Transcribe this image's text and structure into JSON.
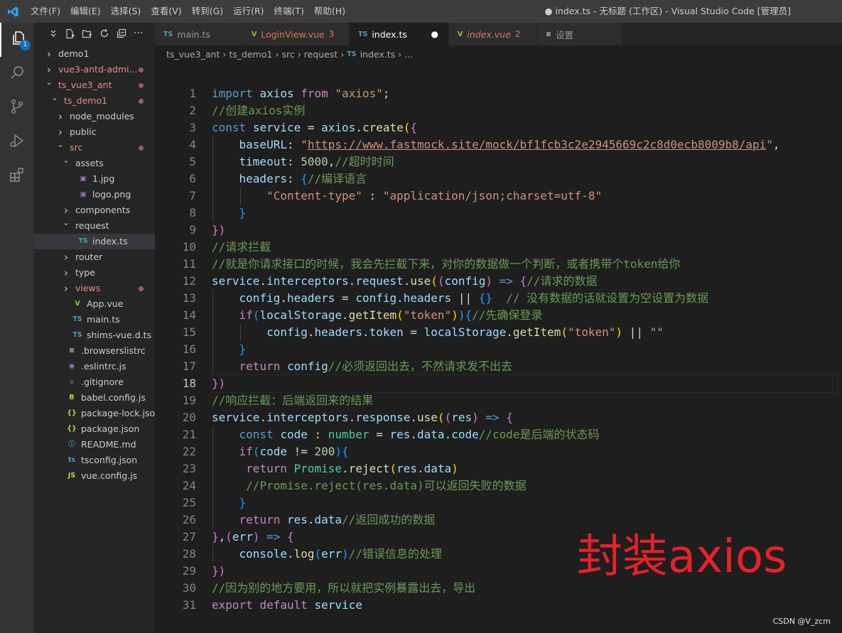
{
  "menu": [
    "文件(F)",
    "编辑(E)",
    "选择(S)",
    "查看(V)",
    "转到(G)",
    "运行(R)",
    "终端(T)",
    "帮助(H)"
  ],
  "window_title": "● index.ts - 无标题 (工作区) - Visual Studio Code [管理员]",
  "activity_badge": "1",
  "tabs": [
    {
      "badge": "TS",
      "label": "main.ts",
      "suffix": ""
    },
    {
      "badge": "V",
      "label": "LoginView.vue",
      "suffix": "3"
    },
    {
      "badge": "TS",
      "label": "index.ts",
      "suffix": "●"
    },
    {
      "badge": "V",
      "label": "index.vue",
      "suffix": "2"
    },
    {
      "badge": "≡",
      "label": "设置",
      "suffix": ""
    }
  ],
  "breadcrumb": [
    "ts_vue3_ant",
    "ts_demo1",
    "src",
    "request",
    "index.ts",
    "..."
  ],
  "explorer": [
    {
      "label": "demo1",
      "kind": "folder-closed",
      "depth": 0,
      "dot": false
    },
    {
      "label": "vue3-antd-admi...",
      "kind": "folder-closed",
      "depth": 0,
      "dot": true
    },
    {
      "label": "ts_vue3_ant",
      "kind": "folder-open",
      "depth": 0,
      "dot": true
    },
    {
      "label": "ts_demo1",
      "kind": "folder-open",
      "depth": 1,
      "dot": true
    },
    {
      "label": "node_modules",
      "kind": "folder-closed",
      "depth": 2,
      "dot": false
    },
    {
      "label": "public",
      "kind": "folder-closed",
      "depth": 2,
      "dot": false
    },
    {
      "label": "src",
      "kind": "folder-open",
      "depth": 2,
      "dot": true
    },
    {
      "label": "assets",
      "kind": "folder-open",
      "depth": 3,
      "dot": false
    },
    {
      "label": "1.jpg",
      "kind": "image",
      "depth": 4,
      "dot": false
    },
    {
      "label": "logo.png",
      "kind": "image",
      "depth": 4,
      "dot": false
    },
    {
      "label": "components",
      "kind": "folder-closed",
      "depth": 3,
      "dot": false
    },
    {
      "label": "request",
      "kind": "folder-open",
      "depth": 3,
      "dot": false
    },
    {
      "label": "index.ts",
      "kind": "ts",
      "depth": 4,
      "dot": false,
      "selected": true
    },
    {
      "label": "router",
      "kind": "folder-closed",
      "depth": 3,
      "dot": false
    },
    {
      "label": "type",
      "kind": "folder-closed",
      "depth": 3,
      "dot": false
    },
    {
      "label": "views",
      "kind": "folder-closed",
      "depth": 3,
      "dot": true
    },
    {
      "label": "App.vue",
      "kind": "vue",
      "depth": 3,
      "dot": false
    },
    {
      "label": "main.ts",
      "kind": "ts",
      "depth": 3,
      "dot": false
    },
    {
      "label": "shims-vue.d.ts",
      "kind": "ts",
      "depth": 3,
      "dot": false
    },
    {
      "label": ".browserslistrc",
      "kind": "lines",
      "depth": 2,
      "dot": false
    },
    {
      "label": ".eslintrc.js",
      "kind": "eslint",
      "depth": 2,
      "dot": false
    },
    {
      "label": ".gitignore",
      "kind": "git",
      "depth": 2,
      "dot": false
    },
    {
      "label": "babel.config.js",
      "kind": "babel",
      "depth": 2,
      "dot": false
    },
    {
      "label": "package-lock.json",
      "kind": "json",
      "depth": 2,
      "dot": false
    },
    {
      "label": "package.json",
      "kind": "json",
      "depth": 2,
      "dot": false
    },
    {
      "label": "README.md",
      "kind": "info",
      "depth": 2,
      "dot": false
    },
    {
      "label": "tsconfig.json",
      "kind": "tsconfig",
      "depth": 2,
      "dot": false
    },
    {
      "label": "vue.config.js",
      "kind": "js",
      "depth": 2,
      "dot": false
    }
  ],
  "current_line": 18,
  "code_lines": [
    [
      [
        "k",
        "import"
      ],
      [
        "p",
        " "
      ],
      [
        "v",
        "axios"
      ],
      [
        "p",
        " "
      ],
      [
        "kc",
        "from"
      ],
      [
        "p",
        " "
      ],
      [
        "s",
        "\"axios\""
      ],
      [
        "p",
        ";"
      ]
    ],
    [
      [
        "c",
        "//创建axios实例"
      ]
    ],
    [
      [
        "k",
        "const"
      ],
      [
        "p",
        " "
      ],
      [
        "v",
        "service"
      ],
      [
        "p",
        " = "
      ],
      [
        "v",
        "axios"
      ],
      [
        "p",
        "."
      ],
      [
        "f",
        "create"
      ],
      [
        "b1",
        "("
      ],
      [
        "b2",
        "{"
      ]
    ],
    [
      [
        "p",
        "    "
      ],
      [
        "v",
        "baseURL"
      ],
      [
        "p",
        ": "
      ],
      [
        "s",
        "\""
      ],
      [
        "su",
        "https://www.fastmock.site/mock/bf1fcb3c2e2945669c2c8d0ecb8009b8/api"
      ],
      [
        "s",
        "\""
      ],
      [
        "p",
        ","
      ]
    ],
    [
      [
        "p",
        "    "
      ],
      [
        "v",
        "timeout"
      ],
      [
        "p",
        ": "
      ],
      [
        "n",
        "5000"
      ],
      [
        "p",
        ","
      ],
      [
        "c",
        "//超时时间"
      ]
    ],
    [
      [
        "p",
        "    "
      ],
      [
        "v",
        "headers"
      ],
      [
        "p",
        ": "
      ],
      [
        "b3",
        "{"
      ],
      [
        "c",
        "//编译语言"
      ]
    ],
    [
      [
        "p",
        "        "
      ],
      [
        "s",
        "\"Content-type\""
      ],
      [
        "p",
        " : "
      ],
      [
        "s",
        "\"application/json;charset=utf-8\""
      ]
    ],
    [
      [
        "p",
        "    "
      ],
      [
        "b3",
        "}"
      ]
    ],
    [
      [
        "b2",
        "})"
      ]
    ],
    [
      [
        "c",
        "//请求拦截"
      ]
    ],
    [
      [
        "c",
        "//就是你请求接口的时候，我会先拦截下来，对你的数据做一个判断，或者携带个token给你"
      ]
    ],
    [
      [
        "v",
        "service"
      ],
      [
        "p",
        "."
      ],
      [
        "v",
        "interceptors"
      ],
      [
        "p",
        "."
      ],
      [
        "v",
        "request"
      ],
      [
        "p",
        "."
      ],
      [
        "f",
        "use"
      ],
      [
        "b1",
        "("
      ],
      [
        "b2",
        "("
      ],
      [
        "v",
        "config"
      ],
      [
        "b2",
        ")"
      ],
      [
        "p",
        " "
      ],
      [
        "k",
        "=>"
      ],
      [
        "p",
        " "
      ],
      [
        "b2",
        "{"
      ],
      [
        "c",
        "//请求的数据"
      ]
    ],
    [
      [
        "p",
        "    "
      ],
      [
        "v",
        "config"
      ],
      [
        "p",
        "."
      ],
      [
        "v",
        "headers"
      ],
      [
        "p",
        " = "
      ],
      [
        "v",
        "config"
      ],
      [
        "p",
        "."
      ],
      [
        "v",
        "headers"
      ],
      [
        "p",
        " || "
      ],
      [
        "b3",
        "{}"
      ],
      [
        "p",
        "  "
      ],
      [
        "c",
        "// 没有数据的话就设置为空设置为数据"
      ]
    ],
    [
      [
        "p",
        "    "
      ],
      [
        "kc",
        "if"
      ],
      [
        "b3",
        "("
      ],
      [
        "v",
        "localStorage"
      ],
      [
        "p",
        "."
      ],
      [
        "f",
        "getItem"
      ],
      [
        "b1",
        "("
      ],
      [
        "s",
        "\"token\""
      ],
      [
        "b1",
        ")"
      ],
      [
        "b3",
        ")"
      ],
      [
        "b3",
        "{"
      ],
      [
        "c",
        "//先确保登录"
      ]
    ],
    [
      [
        "p",
        "        "
      ],
      [
        "v",
        "config"
      ],
      [
        "p",
        "."
      ],
      [
        "v",
        "headers"
      ],
      [
        "p",
        "."
      ],
      [
        "v",
        "token"
      ],
      [
        "p",
        " = "
      ],
      [
        "v",
        "localStorage"
      ],
      [
        "p",
        "."
      ],
      [
        "f",
        "getItem"
      ],
      [
        "b1",
        "("
      ],
      [
        "s",
        "\"token\""
      ],
      [
        "b1",
        ")"
      ],
      [
        "p",
        " || "
      ],
      [
        "s",
        "\"\""
      ]
    ],
    [
      [
        "p",
        "    "
      ],
      [
        "b3",
        "}"
      ]
    ],
    [
      [
        "p",
        "    "
      ],
      [
        "kc",
        "return"
      ],
      [
        "p",
        " "
      ],
      [
        "v",
        "config"
      ],
      [
        "c",
        "//必须返回出去，不然请求发不出去"
      ]
    ],
    [
      [
        "b2",
        "})"
      ]
    ],
    [
      [
        "c",
        "//响应拦截：后端返回来的结果"
      ]
    ],
    [
      [
        "v",
        "service"
      ],
      [
        "p",
        "."
      ],
      [
        "v",
        "interceptors"
      ],
      [
        "p",
        "."
      ],
      [
        "v",
        "response"
      ],
      [
        "p",
        "."
      ],
      [
        "f",
        "use"
      ],
      [
        "b1",
        "("
      ],
      [
        "b2",
        "("
      ],
      [
        "v",
        "res"
      ],
      [
        "b2",
        ")"
      ],
      [
        "p",
        " "
      ],
      [
        "k",
        "=>"
      ],
      [
        "p",
        " "
      ],
      [
        "b2",
        "{"
      ]
    ],
    [
      [
        "p",
        "    "
      ],
      [
        "k",
        "const"
      ],
      [
        "p",
        " "
      ],
      [
        "v",
        "code"
      ],
      [
        "p",
        " : "
      ],
      [
        "t",
        "number"
      ],
      [
        "p",
        " = "
      ],
      [
        "v",
        "res"
      ],
      [
        "p",
        "."
      ],
      [
        "v",
        "data"
      ],
      [
        "p",
        "."
      ],
      [
        "v",
        "code"
      ],
      [
        "c",
        "//code是后端的状态码"
      ]
    ],
    [
      [
        "p",
        "    "
      ],
      [
        "kc",
        "if"
      ],
      [
        "b3",
        "("
      ],
      [
        "v",
        "code"
      ],
      [
        "p",
        " != "
      ],
      [
        "n",
        "200"
      ],
      [
        "b3",
        ")"
      ],
      [
        "b3",
        "{"
      ]
    ],
    [
      [
        "p",
        "     "
      ],
      [
        "kc",
        "return"
      ],
      [
        "p",
        " "
      ],
      [
        "t",
        "Promise"
      ],
      [
        "p",
        "."
      ],
      [
        "f",
        "reject"
      ],
      [
        "b1",
        "("
      ],
      [
        "v",
        "res"
      ],
      [
        "p",
        "."
      ],
      [
        "v",
        "data"
      ],
      [
        "b1",
        ")"
      ]
    ],
    [
      [
        "p",
        "     "
      ],
      [
        "c",
        "//Promise.reject(res.data)可以返回失败的数据"
      ]
    ],
    [
      [
        "p",
        "    "
      ],
      [
        "b3",
        "}"
      ]
    ],
    [
      [
        "p",
        "    "
      ],
      [
        "kc",
        "return"
      ],
      [
        "p",
        " "
      ],
      [
        "v",
        "res"
      ],
      [
        "p",
        "."
      ],
      [
        "v",
        "data"
      ],
      [
        "c",
        "//返回成功的数据"
      ]
    ],
    [
      [
        "b2",
        "}"
      ],
      [
        "p",
        ","
      ],
      [
        "b2",
        "("
      ],
      [
        "v",
        "err"
      ],
      [
        "b2",
        ")"
      ],
      [
        "p",
        " "
      ],
      [
        "k",
        "=>"
      ],
      [
        "p",
        " "
      ],
      [
        "b2",
        "{"
      ]
    ],
    [
      [
        "p",
        "    "
      ],
      [
        "v",
        "console"
      ],
      [
        "p",
        "."
      ],
      [
        "f",
        "log"
      ],
      [
        "b3",
        "("
      ],
      [
        "v",
        "err"
      ],
      [
        "b3",
        ")"
      ],
      [
        "c",
        "//错误信息的处理"
      ]
    ],
    [
      [
        "b2",
        "})"
      ]
    ],
    [
      [
        "c",
        "//因为别的地方要用，所以就把实例暴露出去，导出"
      ]
    ],
    [
      [
        "kc",
        "export"
      ],
      [
        "p",
        " "
      ],
      [
        "kc",
        "default"
      ],
      [
        "p",
        " "
      ],
      [
        "v",
        "service"
      ]
    ]
  ],
  "overlay_text": "封装axios",
  "watermark": "CSDN @V_zcm",
  "colors": {
    "accent": "#0e70c0",
    "overlay": "#e8202a",
    "ts": "#519aba",
    "vue": "#8dc149"
  }
}
